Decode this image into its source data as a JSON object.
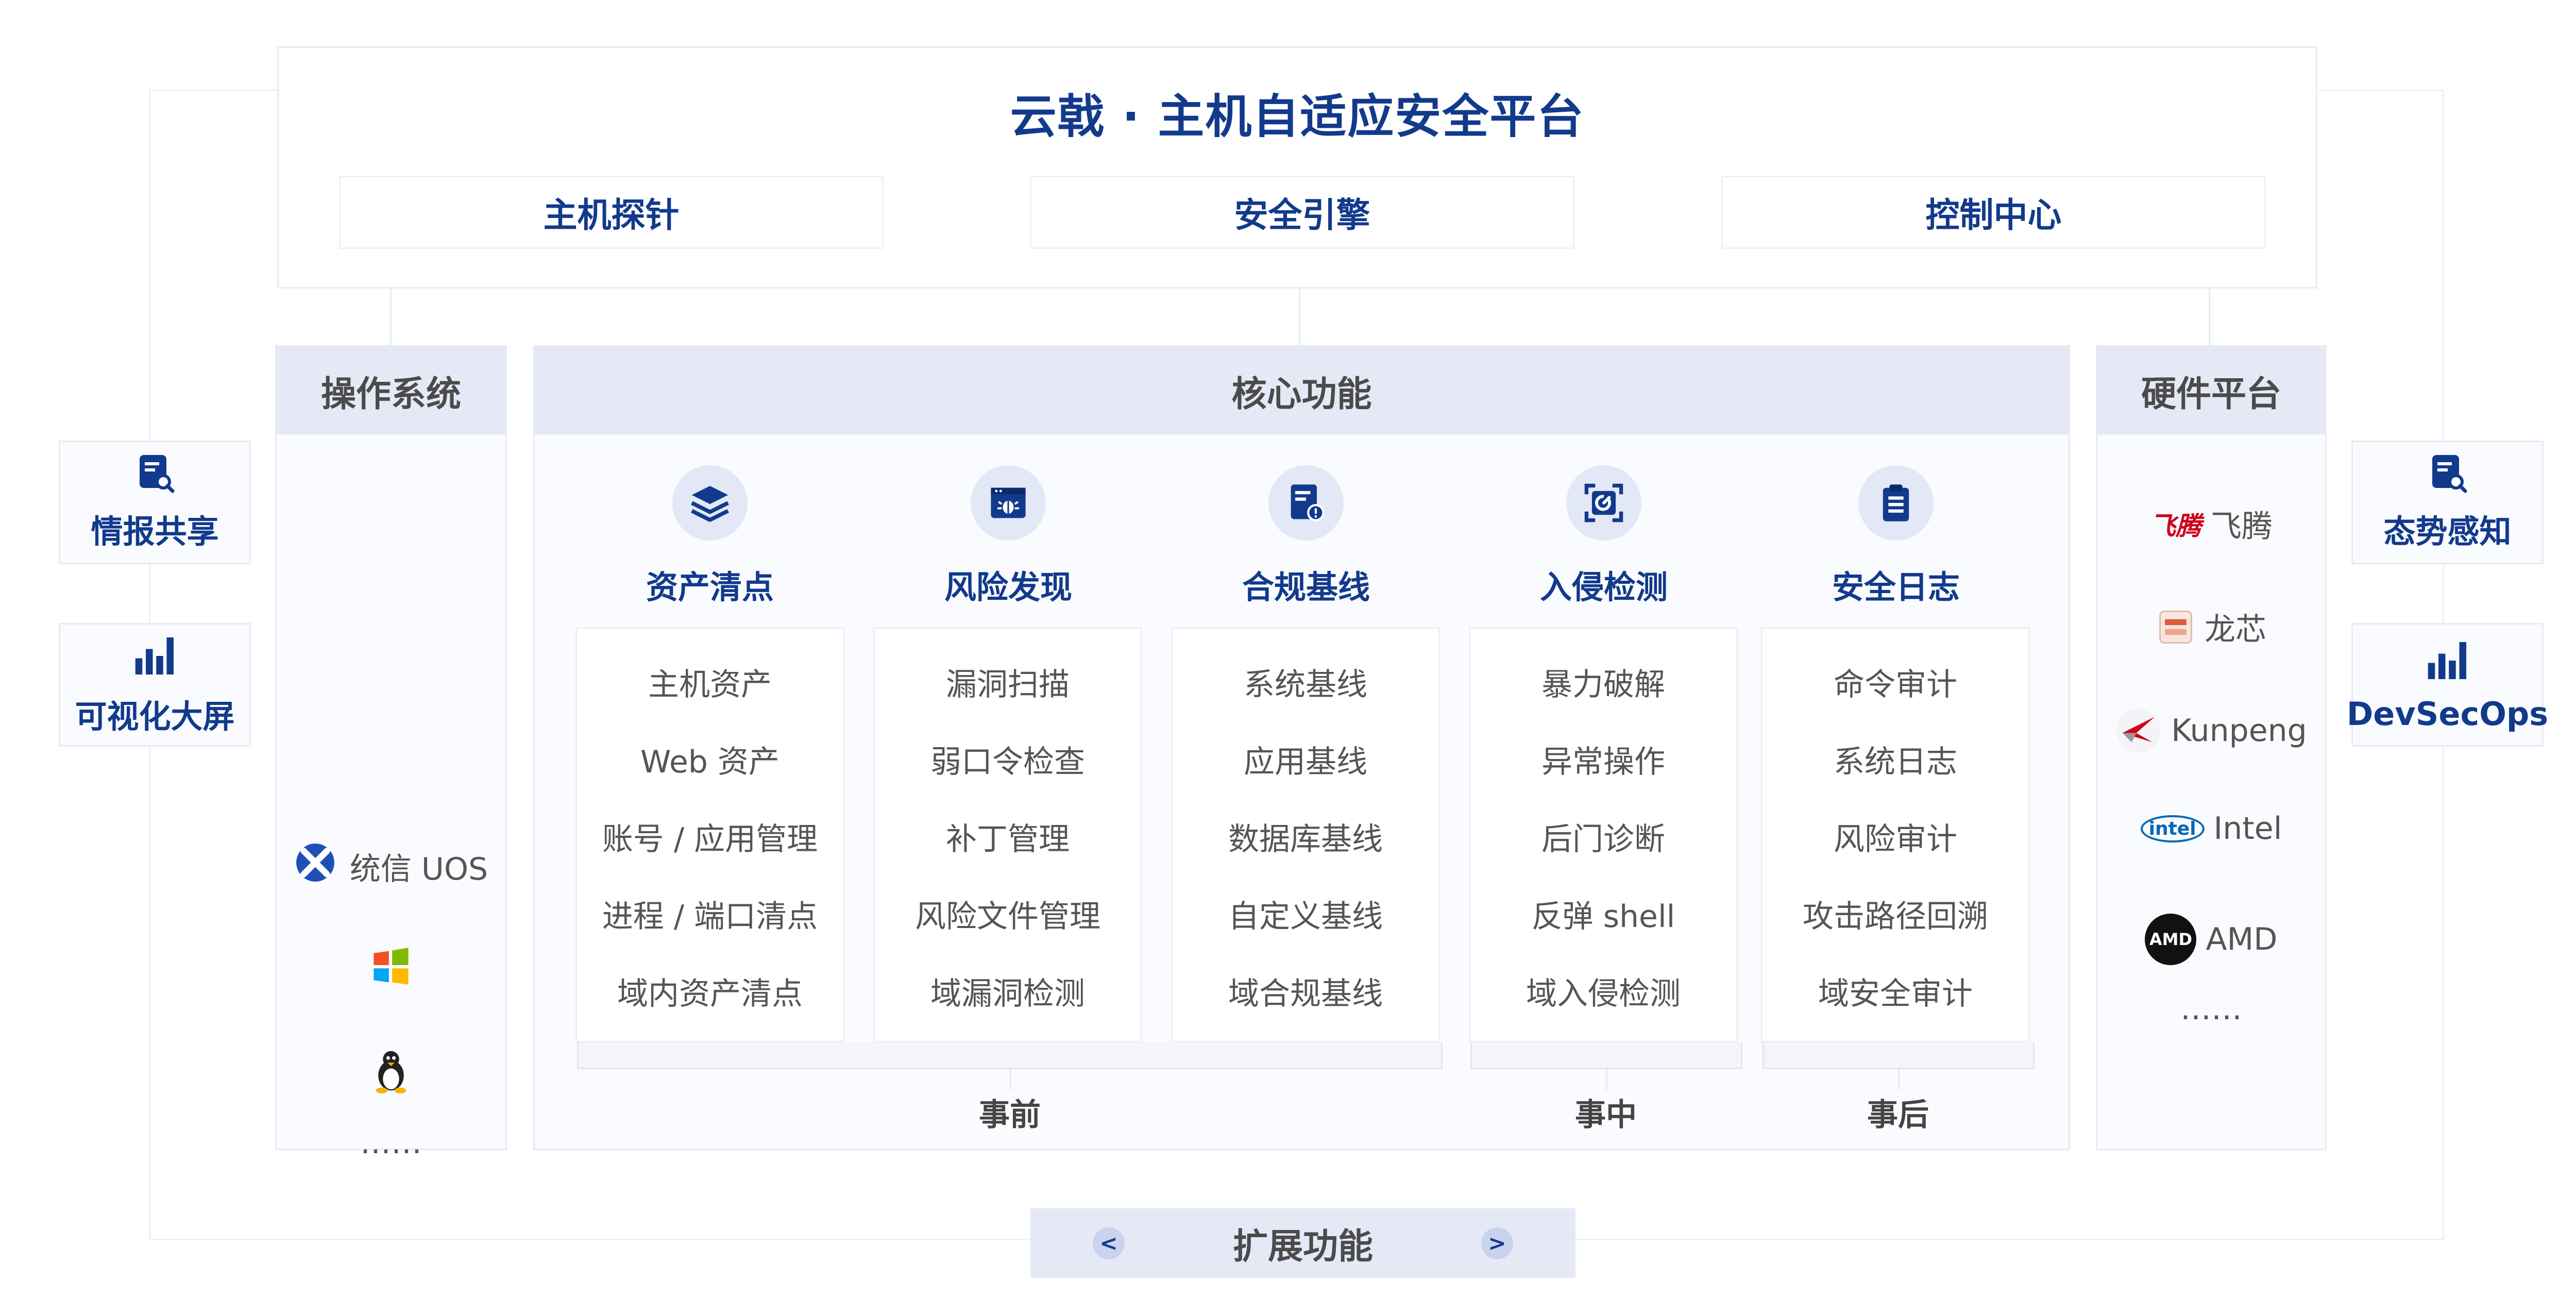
{
  "platform": {
    "title": "云戟 · 主机自适应安全平台",
    "modules": [
      "主机探针",
      "安全引擎",
      "控制中心"
    ]
  },
  "os": {
    "header": "操作系统",
    "items": [
      "统信 UOS"
    ],
    "more": "……"
  },
  "core": {
    "header": "核心功能",
    "features": [
      {
        "title": "资产清点",
        "icon": "layers-icon",
        "items": [
          "主机资产",
          "Web 资产",
          "账号 / 应用管理",
          "进程 / 端口清点",
          "域内资产清点"
        ]
      },
      {
        "title": "风险发现",
        "icon": "bug-window-icon",
        "items": [
          "漏洞扫描",
          "弱口令检查",
          "补丁管理",
          "风险文件管理",
          "域漏洞检测"
        ]
      },
      {
        "title": "合规基线",
        "icon": "compliance-doc-icon",
        "items": [
          "系统基线",
          "应用基线",
          "数据库基线",
          "自定义基线",
          "域合规基线"
        ]
      },
      {
        "title": "入侵检测",
        "icon": "intrusion-scan-icon",
        "items": [
          "暴力破解",
          "异常操作",
          "后门诊断",
          "反弹 shell",
          "域入侵检测"
        ]
      },
      {
        "title": "安全日志",
        "icon": "clipboard-icon",
        "items": [
          "命令审计",
          "系统日志",
          "风险审计",
          "攻击路径回溯",
          "域安全审计"
        ]
      }
    ],
    "phases": {
      "before": "事前",
      "during": "事中",
      "after": "事后"
    }
  },
  "hardware": {
    "header": "硬件平台",
    "items": [
      {
        "logo_text": "飞腾",
        "label": "飞腾"
      },
      {
        "label": "龙芯"
      },
      {
        "label": "Kunpeng"
      },
      {
        "logo_text": "intel",
        "label": "Intel"
      },
      {
        "logo_text": "AMD",
        "label": "AMD"
      }
    ],
    "more": "……"
  },
  "left_side": [
    {
      "label": "情报共享",
      "icon": "report-search-icon"
    },
    {
      "label": "可视化大屏",
      "icon": "bar-chart-icon"
    }
  ],
  "right_side": [
    {
      "label": "态势感知",
      "icon": "report-search-icon"
    },
    {
      "label": "DevSecOps",
      "icon": "bar-chart-icon"
    }
  ],
  "expand": {
    "label": "扩展功能",
    "prev": "<",
    "next": ">"
  },
  "colors": {
    "brand": "#123a8c",
    "header_bg": "#e5e9f5",
    "icon_bg": "#e3e8f7"
  }
}
